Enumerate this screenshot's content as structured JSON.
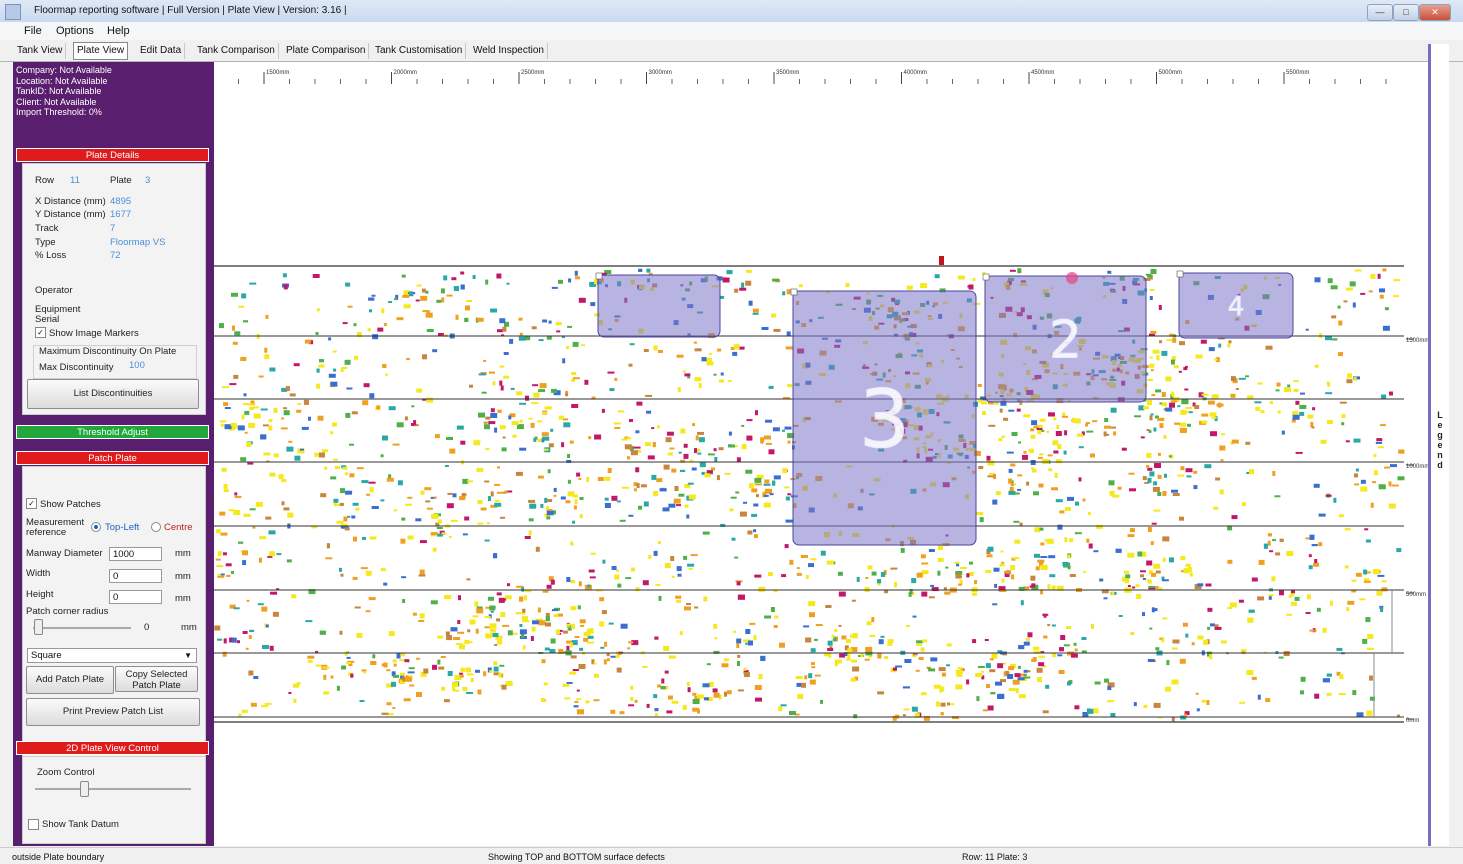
{
  "window": {
    "title": "Floormap reporting software | Full Version | Plate View | Version: 3.16 |"
  },
  "menu": [
    "File",
    "Options",
    "Help"
  ],
  "tabs": [
    "Tank View",
    "Plate View",
    "Edit Data",
    "Tank Comparison",
    "Plate Comparison",
    "Tank Customisation",
    "Weld Inspection"
  ],
  "active_tab": "Plate View",
  "info": {
    "company": "Company: Not Available",
    "location": "Location: Not Available",
    "tank_id": "TankID: Not Available",
    "client": "Client: Not Available",
    "import_threshold": "Import Threshold: 0%"
  },
  "plate_details": {
    "header": "Plate Details",
    "row_label": "Row",
    "row_value": "11",
    "plate_label": "Plate",
    "plate_value": "3",
    "x_label": "X Distance (mm)",
    "x_value": "4895",
    "y_label": "Y Distance (mm)",
    "y_value": "1677",
    "track_label": "Track",
    "track_value": "7",
    "type_label": "Type",
    "type_value": "Floormap VS",
    "loss_label": "% Loss",
    "loss_value": "72",
    "operator_label": "Operator",
    "equipment_label": "Equipment",
    "serial_label": "Serial",
    "show_markers_label": "Show Image Markers",
    "show_markers_checked": true,
    "max_disc_group": "Maximum Discontinuity On Plate",
    "max_disc_label": "Max Discontinuity",
    "max_disc_value": "100",
    "list_button": "List Discontinuities"
  },
  "threshold": {
    "header": "Threshold Adjust"
  },
  "patch": {
    "header": "Patch Plate",
    "show_patches_label": "Show Patches",
    "show_patches_checked": true,
    "measurement_label_1": "Measurement",
    "measurement_label_2": "reference",
    "radio_topleft": "Top-Left",
    "radio_centre": "Centre",
    "manway_label": "Manway Diameter",
    "manway_value": "1000",
    "manway_unit": "mm",
    "width_label": "Width",
    "width_value": "0",
    "width_unit": "mm",
    "height_label": "Height",
    "height_value": "0",
    "height_unit": "mm",
    "radius_label": "Patch corner radius",
    "radius_value": "0",
    "radius_unit": "mm",
    "shape_value": "Square",
    "add_button": "Add Patch Plate",
    "copy_button_1": "Copy Selected",
    "copy_button_2": "Patch Plate",
    "print_button": "Print Preview Patch List"
  },
  "view_control": {
    "header": "2D Plate View Control",
    "zoom_label": "Zoom Control",
    "datum_label": "Show Tank Datum",
    "datum_checked": false
  },
  "ruler": {
    "x_labels": [
      "1500mm",
      "2000mm",
      "2500mm",
      "3000mm",
      "3500mm",
      "4000mm",
      "4500mm",
      "5000mm",
      "5500mm"
    ]
  },
  "y_labels": [
    "1500mm",
    "1000mm",
    "500mm",
    "0mm"
  ],
  "patches": [
    {
      "label": ""
    },
    {
      "label": "3"
    },
    {
      "label": "2"
    },
    {
      "label": "4"
    }
  ],
  "legend": {
    "label": "Legend"
  },
  "colors": {
    "sidebar": "#5a1e6e",
    "header_red": "#e01b1b",
    "header_green": "#20a83c",
    "patch_fill": "#7d77c9",
    "defect_yellow": "#f5e81c",
    "defect_orange": "#f0a020",
    "defect_brown": "#c7853e",
    "defect_green": "#4fb04a",
    "defect_teal": "#2aa8a8",
    "defect_blue": "#3a6fd0",
    "defect_magenta": "#c2186b"
  },
  "status": {
    "left": "outside Plate boundary",
    "center": "Showing TOP and BOTTOM surface defects",
    "right": "Row: 11   Plate: 3"
  }
}
